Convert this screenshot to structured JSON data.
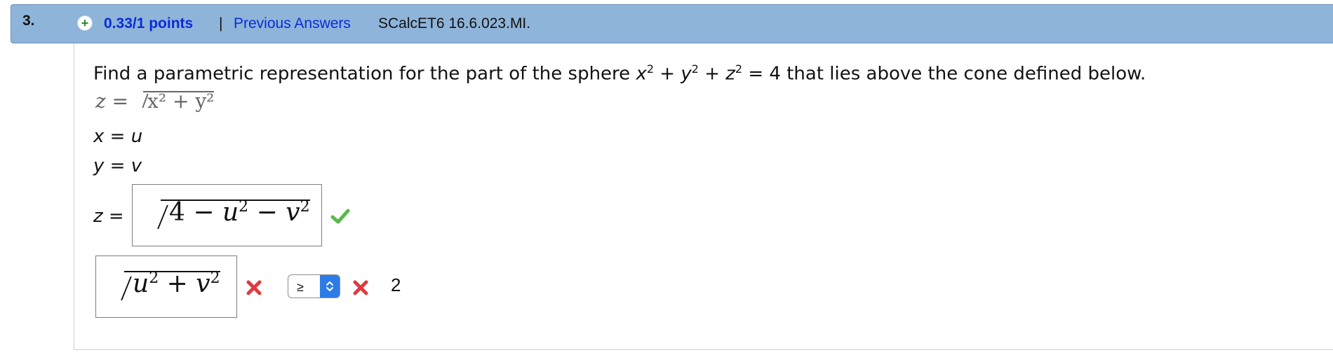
{
  "header": {
    "question_number": "3.",
    "points": "0.33/1 points",
    "separator": "|",
    "previous_answers": "Previous Answers",
    "course_code": "SCalcET6 16.6.023.MI."
  },
  "question": {
    "prompt_start": "Find a parametric representation for the part of the sphere",
    "x": "x",
    "y": "y",
    "z": "z",
    "exp": "2",
    "plus": "+",
    "equals_four": "= 4",
    "prompt_end": "that lies above the cone defined below."
  },
  "cone": {
    "lhs": "z",
    "eq": "=",
    "rhs": "x² + y²"
  },
  "answers": {
    "x": {
      "label": "x",
      "eq": "=",
      "value": "u"
    },
    "y": {
      "label": "y",
      "eq": "=",
      "value": "v"
    },
    "z": {
      "label": "z",
      "eq": "=",
      "expr_prefix": "4 −",
      "u": "u",
      "minus": "−",
      "v": "v",
      "exp": "2"
    }
  },
  "inequality": {
    "lhs_u": "u",
    "lhs_plus": "+",
    "lhs_v": "v",
    "exp": "2",
    "operator": "≥",
    "rhs": "2"
  },
  "icons": {
    "check": "check-icon",
    "cross": "x-icon",
    "plus": "plus-icon"
  },
  "colors": {
    "header_bg": "#8fb4da",
    "link": "#0a2cd6",
    "check": "#58b947",
    "cross": "#e0393f",
    "select_arrow_bg": "#2d7be7"
  }
}
